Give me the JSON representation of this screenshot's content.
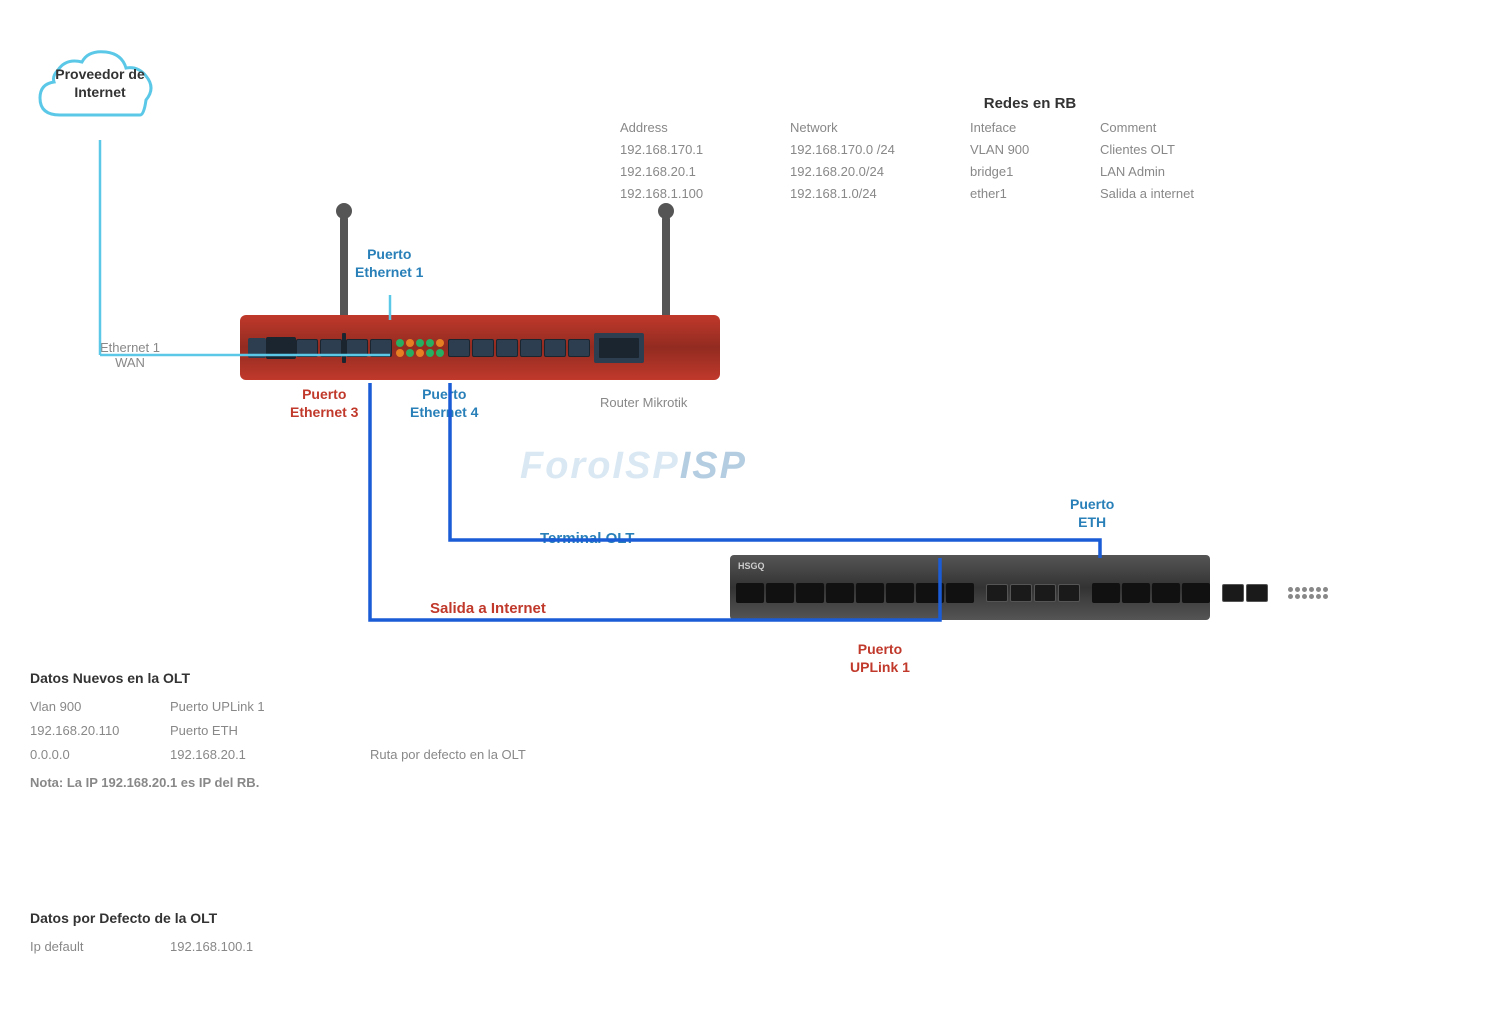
{
  "cloud": {
    "label_line1": "Proveedor de",
    "label_line2": "Internet"
  },
  "redes": {
    "title": "Redes en RB",
    "headers": {
      "address": "Address",
      "network": "Network",
      "interface": "Inteface",
      "comment": "Comment"
    },
    "rows": [
      {
        "address": "192.168.170.1",
        "network": "192.168.170.0 /24",
        "interface": "VLAN 900",
        "comment": "Clientes OLT"
      },
      {
        "address": "192.168.20.1",
        "network": "192.168.20.0/24",
        "interface": "bridge1",
        "comment": "LAN Admin"
      },
      {
        "address": "192.168.1.100",
        "network": "192.168.1.0/24",
        "interface": "ether1",
        "comment": "Salida a internet"
      }
    ]
  },
  "labels": {
    "router_mikrotik": "Router Mikrotik",
    "puerto_ethernet1_line1": "Puerto",
    "puerto_ethernet1_line2": "Ethernet 1",
    "puerto_ethernet3_line1": "Puerto",
    "puerto_ethernet3_line2": "Ethernet 3",
    "puerto_ethernet4_line1": "Puerto",
    "puerto_ethernet4_line2": "Ethernet 4",
    "ethernet1_wan_line1": "Ethernet 1",
    "ethernet1_wan_line2": "WAN",
    "terminal_olt": "Terminal OLT",
    "salida_internet": "Salida a Internet",
    "puerto_eth_line1": "Puerto",
    "puerto_eth_line2": "ETH",
    "puerto_uplink_line1": "Puerto",
    "puerto_uplink_line2": "UPLink 1",
    "watermark": "ForoISP"
  },
  "datos_nuevos": {
    "title": "Datos Nuevos en  la OLT",
    "rows": [
      {
        "col1": "Vlan 900",
        "col2": "Puerto UPLink 1",
        "col3": ""
      },
      {
        "col1": "192.168.20.110",
        "col2": "Puerto ETH",
        "col3": ""
      },
      {
        "col1": "0.0.0.0",
        "col2": "192.168.20.1",
        "col3": "Ruta  por defecto en la OLT"
      }
    ],
    "note": "Nota: La IP 192.168.20.1 es IP del RB."
  },
  "datos_defecto": {
    "title": "Datos por Defecto de la OLT",
    "ip_label": "Ip default",
    "ip_value": "192.168.100.1"
  }
}
